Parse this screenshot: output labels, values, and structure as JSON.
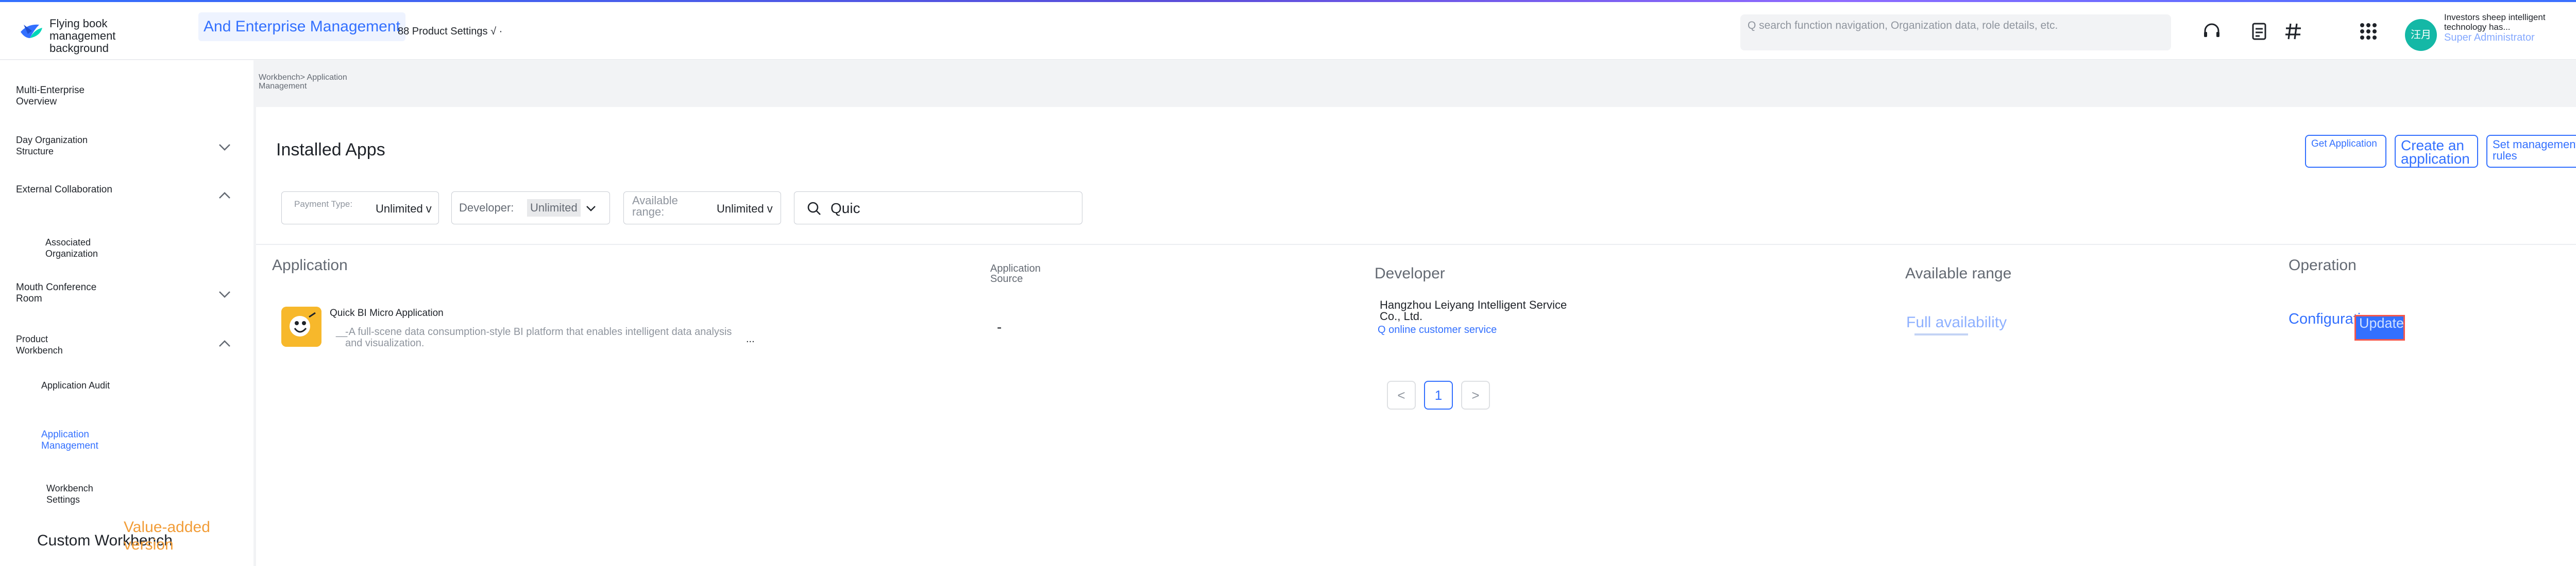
{
  "header": {
    "brand": "Flying book management background",
    "nav_title": "And Enterprise Management",
    "nav_sub": "88 Product Settings √ ·",
    "search_placeholder": "Q search function navigation, Organization data, role details, etc.",
    "avatar_text": "汪月",
    "org": "Investors sheep intelligent technology has...",
    "role": "Super Administrator"
  },
  "sidebar": {
    "items": [
      {
        "label": "Multi-Enterprise Overview"
      },
      {
        "label": "Day Organization Structure"
      },
      {
        "label": "External Collaboration"
      },
      {
        "label": "Associated Organization"
      },
      {
        "label": "Mouth Conference Room"
      },
      {
        "label": "Product Workbench"
      },
      {
        "label": "Application Audit"
      },
      {
        "label": "Application Management"
      },
      {
        "label": "Workbench Settings"
      }
    ],
    "custom_workbench": "Custom Workbench",
    "value_added": "Value-added version"
  },
  "breadcrumb": "Workbench> Application Management",
  "page": {
    "title": "Installed Apps",
    "buttons": {
      "get_application": "Get Application",
      "create_application": "Create an application",
      "set_rules": "Set management rules"
    }
  },
  "filters": {
    "payment_type_label": "Payment Type:",
    "payment_type_value": "Unlimited v",
    "developer_label": "Developer:",
    "developer_value": "Unlimited",
    "range_label": "Available range:",
    "range_value": "Unlimited v",
    "search_value": "Quic"
  },
  "table": {
    "headers": {
      "application": "Application",
      "source": "Application Source",
      "developer": "Developer",
      "range": "Available range",
      "operation": "Operation"
    },
    "rows": [
      {
        "name": "Quick BI Micro Application",
        "desc_lead": "__",
        "description": "-A full-scene data consumption-style BI platform that enables intelligent data analysis and visualization.",
        "more": "...",
        "source": "-",
        "developer": "Hangzhou Leiyang Intelligent Service Co., Ltd.",
        "developer_link": "Q online customer service",
        "range": "Full availability",
        "op_config": "Configuration",
        "op_update": "Update"
      }
    ]
  },
  "pagination": {
    "prev": "<",
    "current": "1",
    "next": ">"
  }
}
